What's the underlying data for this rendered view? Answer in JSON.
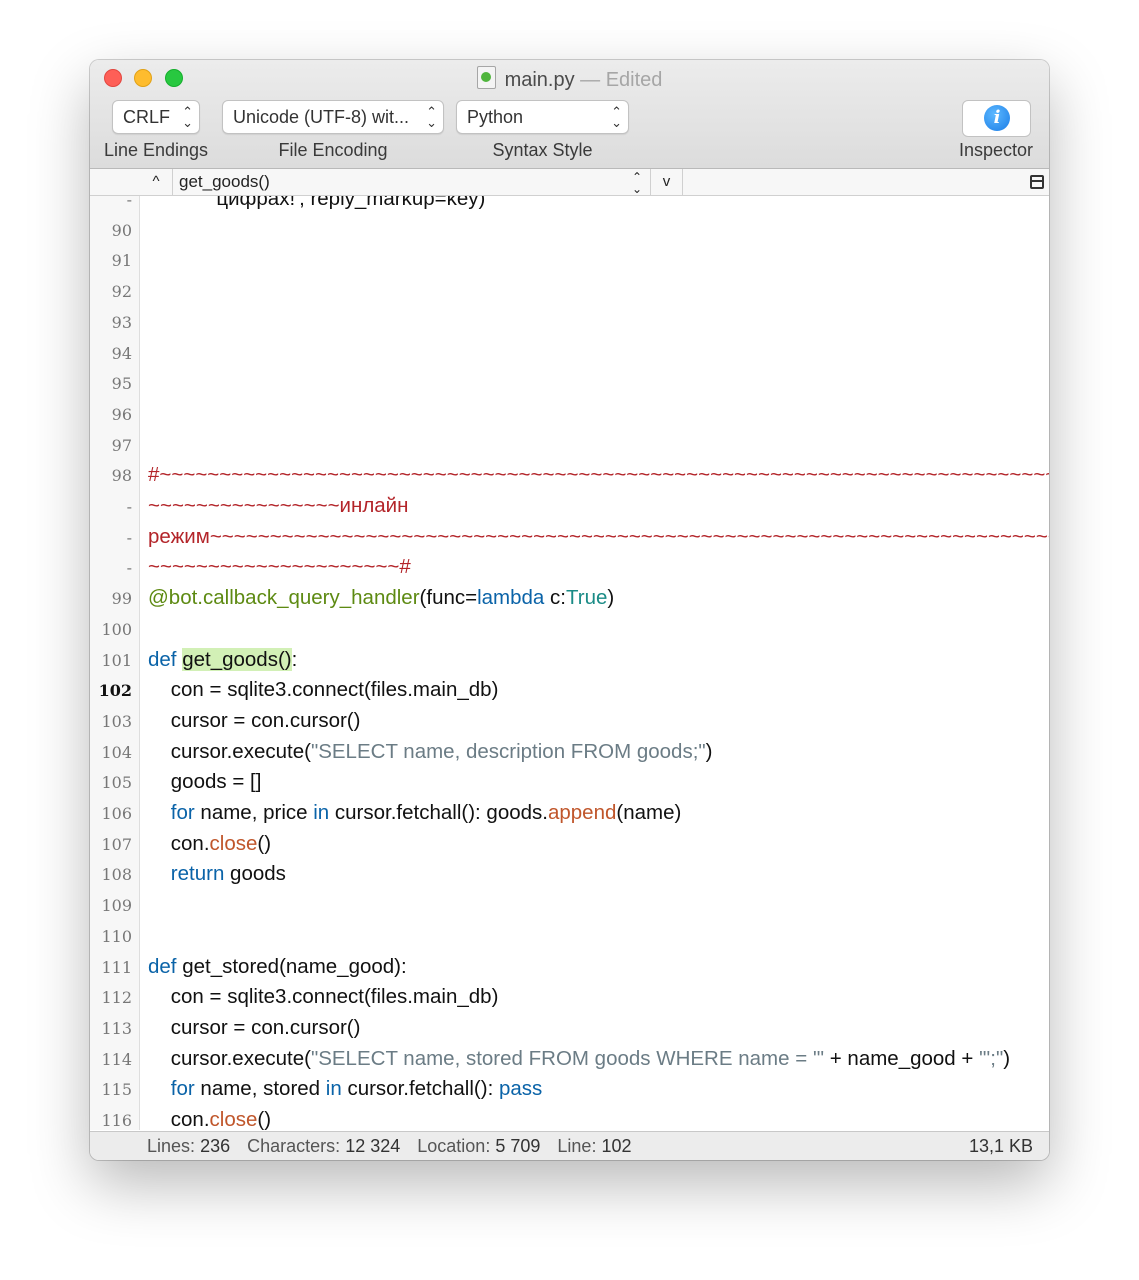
{
  "window": {
    "title": "main.py",
    "subtitle": "— Edited"
  },
  "toolbar": {
    "line_endings": {
      "value": "CRLF",
      "label": "Line Endings"
    },
    "file_encoding": {
      "value": "Unicode (UTF-8) wit...",
      "label": "File Encoding"
    },
    "syntax_style": {
      "value": "Python",
      "label": "Syntax Style"
    },
    "inspector": {
      "label": "Inspector",
      "icon": "i"
    }
  },
  "navigator": {
    "current_function": "get_goods()",
    "prev_glyph": "^",
    "next_glyph": "v"
  },
  "editor": {
    "lines": [
      {
        "num": "-",
        "text": "            цифрах!', reply_markup=key)"
      },
      {
        "num": "90",
        "text": ""
      },
      {
        "num": "91",
        "text": ""
      },
      {
        "num": "92",
        "text": ""
      },
      {
        "num": "93",
        "text": ""
      },
      {
        "num": "94",
        "text": ""
      },
      {
        "num": "95",
        "text": ""
      },
      {
        "num": "96",
        "text": ""
      },
      {
        "num": "97",
        "text": ""
      },
      {
        "num": "98",
        "text": "#~~~~~~~~~~~~~~~~~~~~~~~~~~~~~~~~~~~~~~~~~~~~~~~~~~~~~~~~~~~~~~~~~~~~~~~~~~~~~~"
      },
      {
        "num": "-",
        "text": "~~~~~~~~~~~~~~~~инлайн"
      },
      {
        "num": "-",
        "text": "режим~~~~~~~~~~~~~~~~~~~~~~~~~~~~~~~~~~~~~~~~~~~~~~~~~~~~~~~~~~~~~~~~~~~~~~~~~~"
      },
      {
        "num": "-",
        "text": "~~~~~~~~~~~~~~~~~~~~~#"
      },
      {
        "num": "99",
        "text": "@bot.callback_query_handler(func=lambda c:True)"
      },
      {
        "num": "100",
        "text": ""
      },
      {
        "num": "101",
        "text": "def get_goods():"
      },
      {
        "num": "102",
        "text": "    con = sqlite3.connect(files.main_db)"
      },
      {
        "num": "103",
        "text": "    cursor = con.cursor()"
      },
      {
        "num": "104",
        "text": "    cursor.execute(\"SELECT name, description FROM goods;\")"
      },
      {
        "num": "105",
        "text": "    goods = []"
      },
      {
        "num": "106",
        "text": "    for name, price in cursor.fetchall(): goods.append(name)"
      },
      {
        "num": "107",
        "text": "    con.close()"
      },
      {
        "num": "108",
        "text": "    return goods"
      },
      {
        "num": "109",
        "text": ""
      },
      {
        "num": "110",
        "text": ""
      },
      {
        "num": "111",
        "text": "def get_stored(name_good):"
      },
      {
        "num": "112",
        "text": "    con = sqlite3.connect(files.main_db)"
      },
      {
        "num": "113",
        "text": "    cursor = con.cursor()"
      },
      {
        "num": "114",
        "text": "    cursor.execute(\"SELECT name, stored FROM goods WHERE name = '\" + name_good + \"';\")"
      },
      {
        "num": "115",
        "text": "    for name, stored in cursor.fetchall(): pass"
      },
      {
        "num": "116",
        "text": "    con.close()"
      }
    ]
  },
  "status": {
    "lines_label": "Lines:",
    "lines_value": "236",
    "chars_label": "Characters:",
    "chars_value": "12 324",
    "location_label": "Location:",
    "location_value": "5 709",
    "line_label": "Line:",
    "line_value": "102",
    "file_size": "13,1 KB"
  },
  "colors": {
    "keyword": "#0a63a8",
    "string": "#6b7c85",
    "method": "#c0562b",
    "decorator": "#5d8a12",
    "builtin": "#1a8b86",
    "comment": "#b32429",
    "highlight": "#d2f0b6"
  }
}
